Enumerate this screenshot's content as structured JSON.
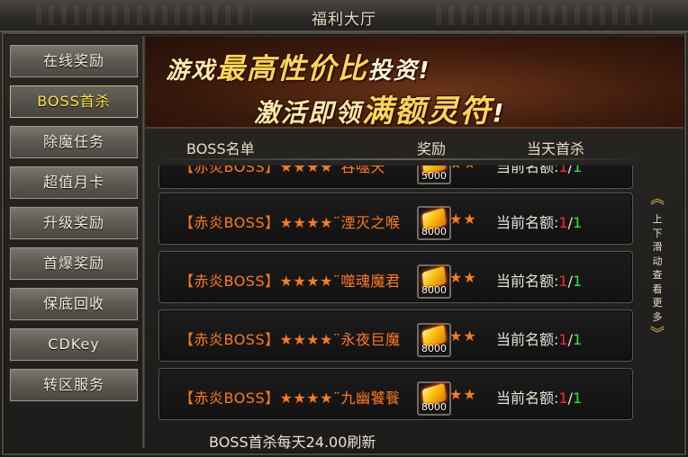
{
  "window": {
    "title": "福利大厅"
  },
  "sidebar": {
    "items": [
      {
        "label": "在线奖励",
        "active": false
      },
      {
        "label": "BOSS首杀",
        "active": true
      },
      {
        "label": "除魔任务",
        "active": false
      },
      {
        "label": "超值月卡",
        "active": false
      },
      {
        "label": "升级奖励",
        "active": false
      },
      {
        "label": "首爆奖励",
        "active": false
      },
      {
        "label": "保底回收",
        "active": false
      },
      {
        "label": "CDKey",
        "active": false
      },
      {
        "label": "转区服务",
        "active": false
      }
    ]
  },
  "banner": {
    "line1": {
      "a": "游戏",
      "b": "最高性价比",
      "c": "投资!"
    },
    "line2": {
      "a": "激活即领",
      "b": "满额灵符",
      "c": "!"
    }
  },
  "list_header": {
    "name": "BOSS名单",
    "reward": "奖励",
    "first_kill": "当天首杀"
  },
  "rows": [
    {
      "name": "【赤炎BOSS】★★★★¨吞噬天",
      "stars_tail": "★★",
      "reward_amount": "5000",
      "quota_label": "当前名额:",
      "quota_current": "1",
      "quota_sep": "/",
      "quota_max": "1"
    },
    {
      "name": "【赤炎BOSS】★★★★¨湮灭之喉",
      "stars_tail": "★★",
      "reward_amount": "8000",
      "quota_label": "当前名额:",
      "quota_current": "1",
      "quota_sep": "/",
      "quota_max": "1"
    },
    {
      "name": "【赤炎BOSS】★★★★¨噬魂魔君",
      "stars_tail": "★★",
      "reward_amount": "8000",
      "quota_label": "当前名额:",
      "quota_current": "1",
      "quota_sep": "/",
      "quota_max": "1"
    },
    {
      "name": "【赤炎BOSS】★★★★¨永夜巨魔",
      "stars_tail": "★★",
      "reward_amount": "8000",
      "quota_label": "当前名额:",
      "quota_current": "1",
      "quota_sep": "/",
      "quota_max": "1"
    },
    {
      "name": "【赤炎BOSS】★★★★¨九幽饕餮",
      "stars_tail": "★★",
      "reward_amount": "8000",
      "quota_label": "当前名额:",
      "quota_current": "1",
      "quota_sep": "/",
      "quota_max": "1"
    }
  ],
  "scroll_hint": {
    "up_icon": "chevron-up-double",
    "text": "上下滑动查看更多",
    "down_icon": "chevron-down-double"
  },
  "footer": {
    "refresh_text": "BOSS首杀每天24.00刷新"
  },
  "colors": {
    "boss_name": "#ff7a1a",
    "quota_current": "#ff2b2b",
    "quota_max": "#36e24a",
    "active_tab_text": "#ffe23c"
  }
}
